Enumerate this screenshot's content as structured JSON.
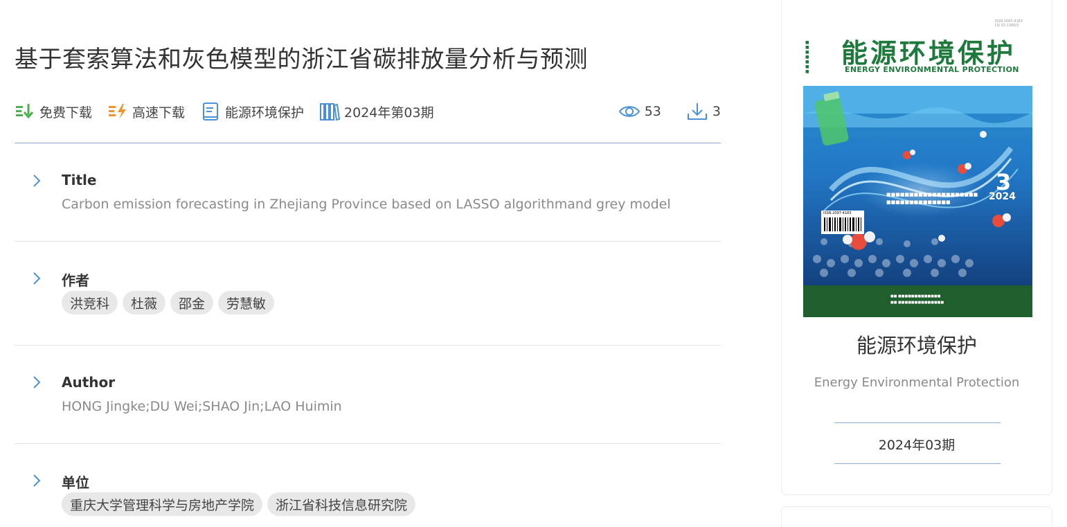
{
  "article": {
    "title": "基于套索算法和灰色模型的浙江省碳排放量分析与预测"
  },
  "meta": {
    "free_download": "免费下载",
    "fast_download": "高速下载",
    "journal": "能源环境保护",
    "issue": "2024年第03期",
    "views": "53",
    "downloads": "3"
  },
  "sections": {
    "title_label": "Title",
    "title_value": "Carbon emission forecasting in Zhejiang Province based on LASSO algorithmand grey model",
    "authors_label": "作者",
    "authors": [
      "洪竞科",
      "杜薇",
      "邵金",
      "劳慧敏"
    ],
    "author_en_label": "Author",
    "author_en_value": "HONG Jingke;DU Wei;SHAO Jin;LAO Huimin",
    "units_label": "单位",
    "units": [
      "重庆大学管理科学与房地产学院",
      "浙江省科技信息研究院"
    ]
  },
  "sidebar": {
    "cover": {
      "title_cn": "能源环境保护",
      "title_en": "ENERGY ENVIRONMENTAL PROTECTION",
      "issue_number": "3",
      "year": "2024"
    },
    "journal_name": "能源环境保护",
    "journal_name_en": "Energy Environmental Protection",
    "issue": "2024年03期"
  },
  "colors": {
    "accent_blue": "#4a90d9",
    "free_green": "#4caf50",
    "fast_orange": "#f0932b",
    "rule_blue": "#8aaccf",
    "cover_green": "#1e7a3c"
  },
  "icons": {
    "free_download": "download-arrows-icon",
    "fast_download": "bolt-download-icon",
    "journal": "journal-icon",
    "issue": "books-icon",
    "views": "eye-icon",
    "downloads": "download-icon",
    "expand": "chevron-right-icon"
  }
}
